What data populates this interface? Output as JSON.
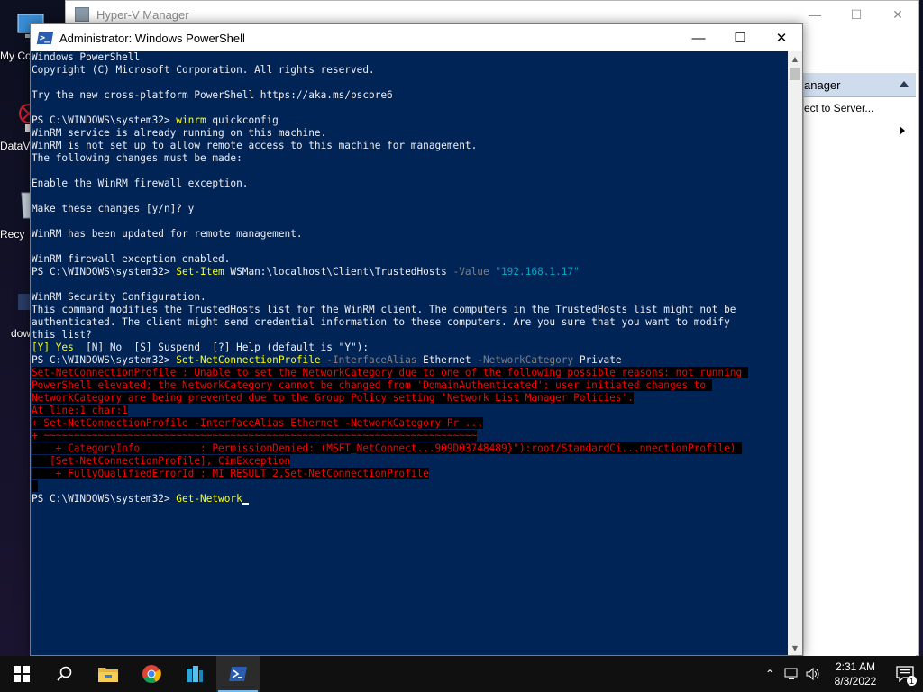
{
  "desktop": {
    "icons": [
      {
        "label": "My Co"
      },
      {
        "label": "DataV"
      },
      {
        "label": "Recy"
      },
      {
        "label": "dow"
      }
    ]
  },
  "hyperv": {
    "title": "Hyper-V Manager",
    "actions_header": "anager",
    "actions_items": [
      "ect to Server...",
      ""
    ]
  },
  "powershell": {
    "title": "Administrator: Windows PowerShell",
    "lines": [
      [
        {
          "t": "Windows PowerShell",
          "c": "norm"
        }
      ],
      [
        {
          "t": "Copyright (C) Microsoft Corporation. All rights reserved.",
          "c": "norm"
        }
      ],
      [
        {
          "t": "",
          "c": "norm"
        }
      ],
      [
        {
          "t": "Try the new cross-platform PowerShell https://aka.ms/pscore6",
          "c": "norm"
        }
      ],
      [
        {
          "t": "",
          "c": "norm"
        }
      ],
      [
        {
          "t": "PS C:\\WINDOWS\\system32> ",
          "c": "norm"
        },
        {
          "t": "winrm",
          "c": "cmd"
        },
        {
          "t": " quickconfig",
          "c": "norm"
        }
      ],
      [
        {
          "t": "WinRM service is already running on this machine.",
          "c": "norm"
        }
      ],
      [
        {
          "t": "WinRM is not set up to allow remote access to this machine for management.",
          "c": "norm"
        }
      ],
      [
        {
          "t": "The following changes must be made:",
          "c": "norm"
        }
      ],
      [
        {
          "t": "",
          "c": "norm"
        }
      ],
      [
        {
          "t": "Enable the WinRM firewall exception.",
          "c": "norm"
        }
      ],
      [
        {
          "t": "",
          "c": "norm"
        }
      ],
      [
        {
          "t": "Make these changes [y/n]? y",
          "c": "norm"
        }
      ],
      [
        {
          "t": "",
          "c": "norm"
        }
      ],
      [
        {
          "t": "WinRM has been updated for remote management.",
          "c": "norm"
        }
      ],
      [
        {
          "t": "",
          "c": "norm"
        }
      ],
      [
        {
          "t": "WinRM firewall exception enabled.",
          "c": "norm"
        }
      ],
      [
        {
          "t": "PS C:\\WINDOWS\\system32> ",
          "c": "norm"
        },
        {
          "t": "Set-Item",
          "c": "cmd"
        },
        {
          "t": " WSMan:\\localhost\\Client\\TrustedHosts ",
          "c": "norm"
        },
        {
          "t": "-Value",
          "c": "param"
        },
        {
          "t": " ",
          "c": "norm"
        },
        {
          "t": "\"192.168.1.17\"",
          "c": "str"
        }
      ],
      [
        {
          "t": "",
          "c": "norm"
        }
      ],
      [
        {
          "t": "WinRM Security Configuration.",
          "c": "norm"
        }
      ],
      [
        {
          "t": "This command modifies the TrustedHosts list for the WinRM client. The computers in the TrustedHosts list might not be",
          "c": "norm"
        }
      ],
      [
        {
          "t": "authenticated. The client might send credential information to these computers. Are you sure that you want to modify",
          "c": "norm"
        }
      ],
      [
        {
          "t": "this list?",
          "c": "norm"
        }
      ],
      [
        {
          "t": "[Y] Yes",
          "c": "yel"
        },
        {
          "t": "  [N] No  [S] Suspend  [?] Help (default is \"Y\"):",
          "c": "norm"
        }
      ],
      [
        {
          "t": "PS C:\\WINDOWS\\system32> ",
          "c": "norm"
        },
        {
          "t": "Set-NetConnectionProfile",
          "c": "cmd"
        },
        {
          "t": " ",
          "c": "norm"
        },
        {
          "t": "-InterfaceAlias",
          "c": "param"
        },
        {
          "t": " Ethernet ",
          "c": "norm"
        },
        {
          "t": "-NetworkCategory",
          "c": "param"
        },
        {
          "t": " Private",
          "c": "norm"
        }
      ],
      [
        {
          "t": "Set-NetConnectionProfile : Unable to set the NetworkCategory due to one of the following possible reasons: not running ",
          "c": "err"
        }
      ],
      [
        {
          "t": "PowerShell elevated; the NetworkCategory cannot be changed from 'DomainAuthenticated'; user initiated changes to ",
          "c": "err"
        }
      ],
      [
        {
          "t": "NetworkCategory are being prevented due to the Group Policy setting 'Network List Manager Policies'.",
          "c": "err"
        }
      ],
      [
        {
          "t": "At line:1 char:1",
          "c": "err"
        }
      ],
      [
        {
          "t": "+ Set-NetConnectionProfile -InterfaceAlias Ethernet -NetworkCategory Pr ...",
          "c": "err"
        }
      ],
      [
        {
          "t": "+ ~~~~~~~~~~~~~~~~~~~~~~~~~~~~~~~~~~~~~~~~~~~~~~~~~~~~~~~~~~~~~~~~~~~~~~~~",
          "c": "err"
        }
      ],
      [
        {
          "t": "    + CategoryInfo          : PermissionDenied: (MSFT_NetConnect...909D03748489}\"):root/StandardCi...nnectionProfile) ",
          "c": "err"
        }
      ],
      [
        {
          "t": "   [Set-NetConnectionProfile], CimException",
          "c": "err"
        }
      ],
      [
        {
          "t": "    + FullyQualifiedErrorId : MI RESULT 2,Set-NetConnectionProfile",
          "c": "err"
        }
      ],
      [
        {
          "t": " ",
          "c": "err"
        }
      ],
      [
        {
          "t": "PS C:\\WINDOWS\\system32> ",
          "c": "norm"
        },
        {
          "t": "Get-Network",
          "c": "cmd"
        }
      ]
    ]
  },
  "taskbar": {
    "time": "2:31 AM",
    "date": "8/3/2022",
    "notification_count": "1"
  },
  "colors": {
    "console_bg": "#012456",
    "command": "#ffff00",
    "parameter": "#808080",
    "string": "#00a4c6",
    "error_fg": "#ff0000",
    "error_bg": "#000000"
  }
}
